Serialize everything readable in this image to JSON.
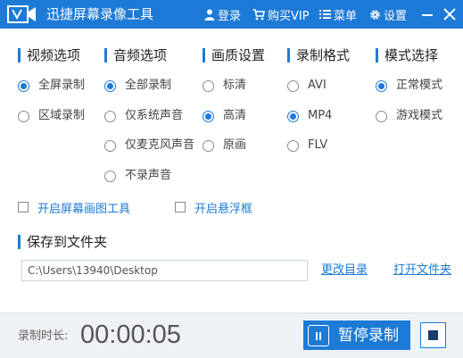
{
  "app": {
    "title": "迅捷屏幕录像工具"
  },
  "toolbar": {
    "login": "登录",
    "buy_vip": "购买VIP",
    "menu": "菜单",
    "settings": "设置"
  },
  "sections": {
    "video": {
      "title": "视频选项",
      "options": [
        {
          "label": "全屏录制",
          "checked": true
        },
        {
          "label": "区域录制",
          "checked": false
        }
      ]
    },
    "audio": {
      "title": "音频选项",
      "options": [
        {
          "label": "全部录制",
          "checked": true
        },
        {
          "label": "仅系统声音",
          "checked": false
        },
        {
          "label": "仅麦克风声音",
          "checked": false
        },
        {
          "label": "不录声音",
          "checked": false
        }
      ]
    },
    "quality": {
      "title": "画质设置",
      "options": [
        {
          "label": "标清",
          "checked": false
        },
        {
          "label": "高清",
          "checked": true
        },
        {
          "label": "原画",
          "checked": false
        }
      ]
    },
    "format": {
      "title": "录制格式",
      "options": [
        {
          "label": "AVI",
          "checked": false
        },
        {
          "label": "MP4",
          "checked": true
        },
        {
          "label": "FLV",
          "checked": false
        }
      ]
    },
    "mode": {
      "title": "模式选择",
      "options": [
        {
          "label": "正常模式",
          "checked": true
        },
        {
          "label": "游戏模式",
          "checked": false
        }
      ]
    }
  },
  "checkboxes": {
    "screen_draw_tool": {
      "label": "开启屏幕画图工具",
      "checked": false
    },
    "float_window": {
      "label": "开启悬浮框",
      "checked": false
    }
  },
  "save": {
    "title": "保存到文件夹",
    "path": "C:\\Users\\13940\\Desktop",
    "change_dir": "更改目录",
    "open_folder": "打开文件夹"
  },
  "status": {
    "duration_label": "录制时长:",
    "duration": "00:00:05",
    "pause_label": "暂停录制"
  },
  "colors": {
    "accent": "#1d7ad6",
    "titlebar": "#1d7ad6",
    "bottom_bar": "#eef1f5"
  }
}
